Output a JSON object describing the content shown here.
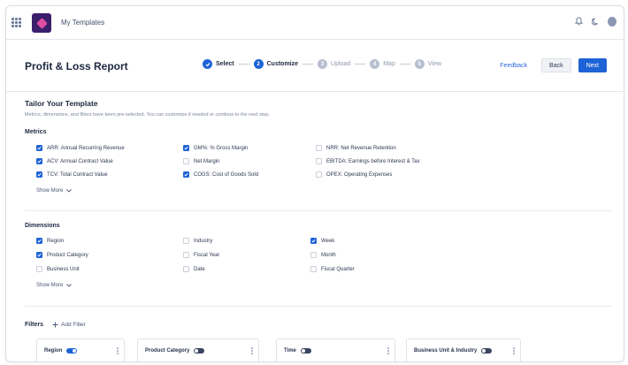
{
  "app": {
    "title": "My Templates"
  },
  "header": {
    "title": "Profit & Loss Report",
    "steps": [
      {
        "label": "Select",
        "number": "1",
        "state": "done"
      },
      {
        "label": "Customize",
        "number": "2",
        "state": "active"
      },
      {
        "label": "Upload",
        "number": "3",
        "state": "todo"
      },
      {
        "label": "Map",
        "number": "4",
        "state": "todo"
      },
      {
        "label": "View",
        "number": "5",
        "state": "todo"
      }
    ],
    "feedback_label": "Feedback",
    "back_label": "Back",
    "next_label": "Next"
  },
  "tailor": {
    "title": "Tailor Your Template",
    "subtitle": "Metrics, dimensions, and filters have been pre-selected. You can customize if needed or continue to the next step."
  },
  "metrics": {
    "label": "Metrics",
    "items": [
      {
        "label": "ARR: Annual Recurring Revenue",
        "checked": true
      },
      {
        "label": "ACV: Annual Contract Value",
        "checked": true
      },
      {
        "label": "TCV: Total Contract Value",
        "checked": true
      },
      {
        "label": "GM%: % Gross Margin",
        "checked": true
      },
      {
        "label": "Net Margin",
        "checked": false
      },
      {
        "label": "COGS: Cost of Goods Sold",
        "checked": true
      },
      {
        "label": "NRR: Net Revenue Retention",
        "checked": false
      },
      {
        "label": "EBITDA: Earnings before Interest & Tax",
        "checked": false
      },
      {
        "label": "OPEX: Operating Expenses",
        "checked": false
      }
    ],
    "show_more": "Show More"
  },
  "dimensions": {
    "label": "Dimensions",
    "items": [
      {
        "label": "Region",
        "checked": true
      },
      {
        "label": "Product Category",
        "checked": true
      },
      {
        "label": "Business Unit",
        "checked": false
      },
      {
        "label": "Industry",
        "checked": false
      },
      {
        "label": "Fiscal Year",
        "checked": false
      },
      {
        "label": "Date",
        "checked": false
      },
      {
        "label": "Week",
        "checked": true
      },
      {
        "label": "Month",
        "checked": false
      },
      {
        "label": "Fiscal Quarter",
        "checked": false
      }
    ],
    "show_more": "Show More"
  },
  "filters": {
    "label": "Filters",
    "add_label": "Add Filter",
    "chips": [
      {
        "label": "Region",
        "enabled": true
      },
      {
        "label": "Product Category",
        "enabled": false
      },
      {
        "label": "Time",
        "enabled": false
      },
      {
        "label": "Business Unit & Industry",
        "enabled": false
      }
    ]
  },
  "colors": {
    "accent": "#1e63d6",
    "brand": "#3b1f6b",
    "brand_mark": "#e24ea3"
  }
}
